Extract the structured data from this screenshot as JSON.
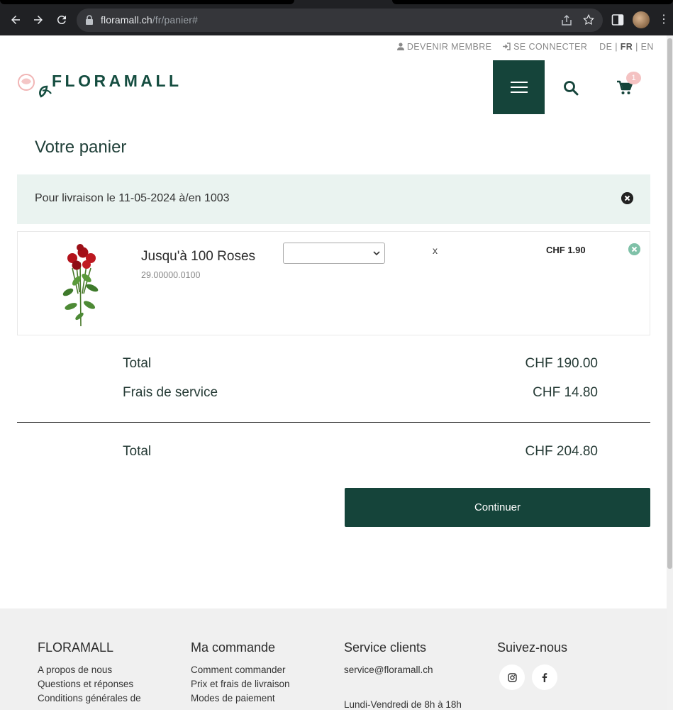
{
  "browser": {
    "url_host": "floramall.ch",
    "url_path": "/fr/panier#"
  },
  "toplinks": {
    "member": "DEVENIR MEMBRE",
    "login": "SE CONNECTER",
    "lang_de": "DE",
    "lang_fr": "FR",
    "lang_en": "EN",
    "sep": "|"
  },
  "header": {
    "logo_text": "FLORAMALL",
    "cart_count": "1"
  },
  "page": {
    "title": "Votre panier"
  },
  "delivery": {
    "text": "Pour livraison le 11-05-2024 à/en 1003"
  },
  "item": {
    "name": "Jusqu'à 100 Roses",
    "sku": "29.00000.0100",
    "select_value": "",
    "multiply": "x",
    "price": "CHF 1.90"
  },
  "summary": {
    "total_label": "Total",
    "total_value": "CHF 190.00",
    "fee_label": "Frais de service",
    "fee_value": "CHF 14.80",
    "grand_label": "Total",
    "grand_value": "CHF 204.80"
  },
  "actions": {
    "continue_label": "Continuer"
  },
  "footer": {
    "col1": {
      "title": "FLORAMALL",
      "links": [
        "A propos de nous",
        "Questions et réponses",
        "Conditions générales de"
      ]
    },
    "col2": {
      "title": "Ma commande",
      "links": [
        "Comment commander",
        "Prix et frais de livraison",
        "Modes de paiement"
      ]
    },
    "col3": {
      "title": "Service clients",
      "email": "service@floramall.ch",
      "hours": "Lundi-Vendredi de 8h à 18h"
    },
    "col4": {
      "title": "Suivez-nous"
    }
  },
  "colors": {
    "brand_green": "#15443a",
    "banner_bg": "#eaf3f0",
    "badge_pink": "#f4c2c2",
    "remove_green": "#7fc1a8"
  }
}
